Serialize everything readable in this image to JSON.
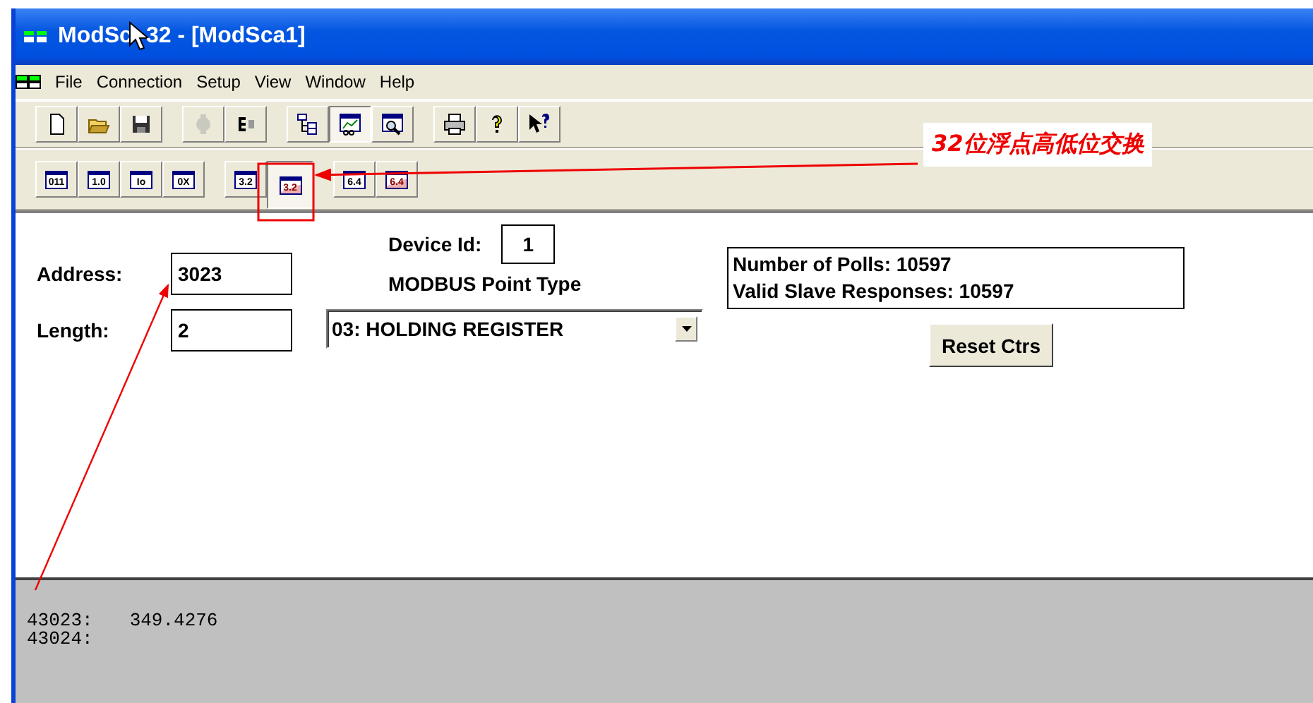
{
  "window": {
    "title_before_cursor": "ModSc",
    "title_after_cursor": "32 - [ModSca1]"
  },
  "menu": [
    "File",
    "Connection",
    "Setup",
    "View",
    "Window",
    "Help"
  ],
  "toolbar": [
    {
      "kind": "new",
      "pressed": false,
      "disabled": false
    },
    {
      "kind": "open",
      "pressed": false,
      "disabled": false
    },
    {
      "kind": "save",
      "pressed": false,
      "disabled": false
    },
    {
      "kind": "separator"
    },
    {
      "kind": "connect",
      "pressed": false,
      "disabled": true
    },
    {
      "kind": "disconnect",
      "pressed": false,
      "disabled": false
    },
    {
      "kind": "separator"
    },
    {
      "kind": "tree",
      "pressed": false,
      "disabled": false
    },
    {
      "kind": "chart",
      "pressed": true,
      "disabled": false
    },
    {
      "kind": "inspect",
      "pressed": false,
      "disabled": false
    },
    {
      "kind": "separator"
    },
    {
      "kind": "print",
      "pressed": false,
      "disabled": false
    },
    {
      "kind": "help",
      "pressed": false,
      "disabled": false
    },
    {
      "kind": "whatsthis",
      "pressed": false,
      "disabled": false
    }
  ],
  "format_toolbar": [
    {
      "kind": "button",
      "label": "011",
      "pressed": false,
      "swapped": false
    },
    {
      "kind": "button",
      "label": "1.0",
      "pressed": false,
      "swapped": false
    },
    {
      "kind": "button",
      "label": "Io",
      "pressed": false,
      "swapped": false
    },
    {
      "kind": "button",
      "label": "0X",
      "pressed": false,
      "swapped": false
    },
    {
      "kind": "separator"
    },
    {
      "kind": "button",
      "label": "3.2",
      "pressed": false,
      "swapped": false
    },
    {
      "kind": "button",
      "label": "3.2",
      "pressed": true,
      "swapped": true
    },
    {
      "kind": "separator"
    },
    {
      "kind": "button",
      "label": "6.4",
      "pressed": false,
      "swapped": false
    },
    {
      "kind": "button",
      "label": "6.4",
      "pressed": false,
      "swapped": true
    }
  ],
  "form": {
    "address": {
      "label": "Address:",
      "value": "3023"
    },
    "length": {
      "label": "Length:",
      "value": "2"
    },
    "device_id": {
      "label": "Device Id:",
      "value": "1"
    },
    "point_type": {
      "label": "MODBUS Point Type",
      "value": "03: HOLDING REGISTER"
    },
    "counters": [
      "Number of Polls: 10597",
      "Valid Slave Responses: 10597"
    ],
    "reset_button": "Reset Ctrs"
  },
  "display": [
    {
      "address": "43023:",
      "value": "349.4276"
    },
    {
      "address": "43024:"
    }
  ],
  "annotation": {
    "text": "32位浮点高低位交换"
  }
}
